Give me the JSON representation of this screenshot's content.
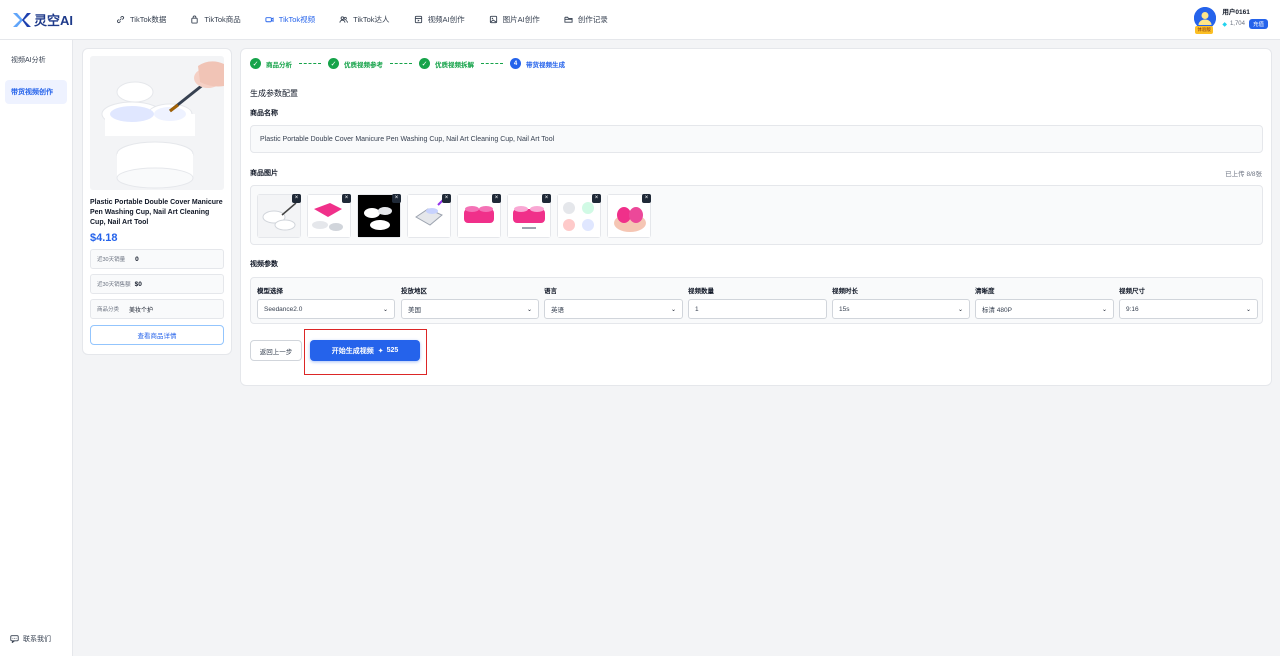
{
  "header": {
    "logo_text": "灵空AI",
    "nav": [
      {
        "label": "TikTok数据",
        "icon": "link-icon"
      },
      {
        "label": "TikTok商品",
        "icon": "shopping-bag-icon"
      },
      {
        "label": "TikTok视频",
        "icon": "video-icon",
        "active": true
      },
      {
        "label": "TikTok达人",
        "icon": "users-icon"
      },
      {
        "label": "视频AI创作",
        "icon": "video-create-icon"
      },
      {
        "label": "图片AI创作",
        "icon": "image-icon"
      },
      {
        "label": "创作记录",
        "icon": "folder-icon"
      }
    ],
    "user": {
      "name": "用户0161",
      "badge": "体验版",
      "credits": "1,704",
      "recharge_label": "充值"
    }
  },
  "sidebar": {
    "items": [
      {
        "label": "视频AI分析",
        "active": false
      },
      {
        "label": "带货视频创作",
        "active": true
      }
    ],
    "contact_label": "联系我们"
  },
  "product": {
    "title": "Plastic Portable Double Cover Manicure Pen Washing Cup, Nail Art Cleaning Cup, Nail Art Tool",
    "price": "$4.18",
    "stats": [
      {
        "label": "近30天销量",
        "value": "0"
      },
      {
        "label": "近30天销售额",
        "value": "$0"
      },
      {
        "label": "商品分类",
        "value": "美妆个护"
      }
    ],
    "detail_button": "查看商品详情"
  },
  "steps": [
    {
      "label": "商品分析",
      "status": "done"
    },
    {
      "label": "优质视频参考",
      "status": "done"
    },
    {
      "label": "优质视频拆解",
      "status": "done"
    },
    {
      "label": "带货视频生成",
      "status": "current",
      "number": "4"
    }
  ],
  "form": {
    "section_title": "生成参数配置",
    "name_label": "商品名称",
    "name_value": "Plastic Portable Double Cover Manicure Pen Washing Cup, Nail Art Cleaning Cup, Nail Art Tool",
    "images_label": "商品图片",
    "upload_count": "已上传 8/8张",
    "video_params_label": "视频参数",
    "params": [
      {
        "label": "模型选择",
        "value": "Seedance2.0",
        "type": "select"
      },
      {
        "label": "投放地区",
        "value": "美国",
        "type": "select"
      },
      {
        "label": "语言",
        "value": "英语",
        "type": "select"
      },
      {
        "label": "视频数量",
        "value": "1",
        "type": "input"
      },
      {
        "label": "视频时长",
        "value": "15s",
        "type": "select"
      },
      {
        "label": "清晰度",
        "value": "标清 480P",
        "type": "select"
      },
      {
        "label": "视频尺寸",
        "value": "9:16",
        "type": "select"
      }
    ],
    "back_button": "返回上一步",
    "generate_button": "开始生成视频",
    "generate_cost": "525"
  },
  "colors": {
    "accent": "#2563eb",
    "success": "#16a34a",
    "highlight": "#dc2626",
    "pink": "#f0308a"
  }
}
